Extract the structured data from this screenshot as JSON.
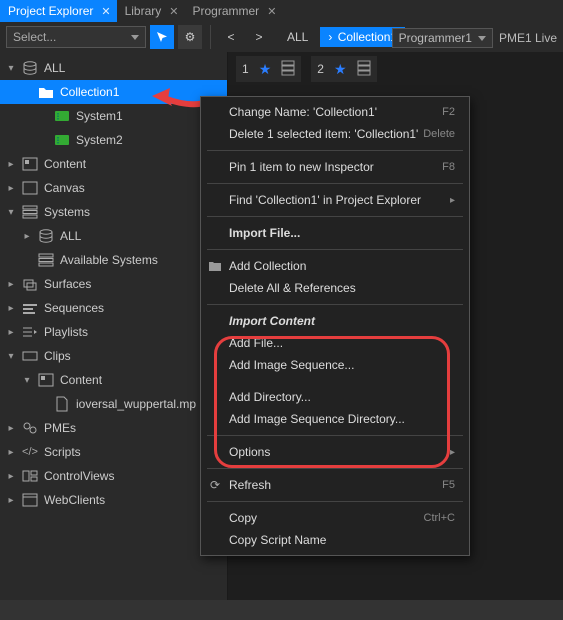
{
  "tabs": [
    {
      "label": "Project Explorer",
      "active": true
    },
    {
      "label": "Library",
      "active": false
    },
    {
      "label": "Programmer",
      "active": false
    }
  ],
  "toolbar": {
    "select_placeholder": "Select...",
    "nav_back": "<",
    "nav_fwd": ">"
  },
  "breadcrumb": [
    {
      "label": "ALL",
      "active": false
    },
    {
      "label": "Collection1",
      "active": true
    }
  ],
  "header_right": {
    "dropdown": "Programmer1",
    "pme": "PME1 Live"
  },
  "thumbs": [
    {
      "num": "1"
    },
    {
      "num": "2"
    }
  ],
  "tree": [
    {
      "indent": 0,
      "exp": "down",
      "icon": "db",
      "label": "ALL"
    },
    {
      "indent": 1,
      "exp": "",
      "icon": "folder",
      "label": "Collection1",
      "selected": true
    },
    {
      "indent": 2,
      "exp": "",
      "icon": "system",
      "label": "System1"
    },
    {
      "indent": 2,
      "exp": "",
      "icon": "system",
      "label": "System2"
    },
    {
      "indent": 0,
      "exp": "right",
      "icon": "content",
      "label": "Content"
    },
    {
      "indent": 0,
      "exp": "right",
      "icon": "canvas",
      "label": "Canvas"
    },
    {
      "indent": 0,
      "exp": "down",
      "icon": "systems",
      "label": "Systems"
    },
    {
      "indent": 1,
      "exp": "right",
      "icon": "db",
      "label": "ALL"
    },
    {
      "indent": 1,
      "exp": "",
      "icon": "systems",
      "label": "Available Systems"
    },
    {
      "indent": 0,
      "exp": "right",
      "icon": "surfaces",
      "label": "Surfaces"
    },
    {
      "indent": 0,
      "exp": "right",
      "icon": "sequences",
      "label": "Sequences"
    },
    {
      "indent": 0,
      "exp": "right",
      "icon": "playlists",
      "label": "Playlists"
    },
    {
      "indent": 0,
      "exp": "down",
      "icon": "clips",
      "label": "Clips"
    },
    {
      "indent": 1,
      "exp": "down",
      "icon": "content",
      "label": "Content"
    },
    {
      "indent": 2,
      "exp": "",
      "icon": "file",
      "label": "ioversal_wuppertal.mp"
    },
    {
      "indent": 0,
      "exp": "right",
      "icon": "pmes",
      "label": "PMEs"
    },
    {
      "indent": 0,
      "exp": "right",
      "icon": "scripts",
      "label": "Scripts"
    },
    {
      "indent": 0,
      "exp": "right",
      "icon": "views",
      "label": "ControlViews"
    },
    {
      "indent": 0,
      "exp": "right",
      "icon": "web",
      "label": "WebClients"
    }
  ],
  "menu": [
    {
      "type": "item",
      "label": "Change Name: 'Collection1'",
      "shortcut": "F2"
    },
    {
      "type": "item",
      "label": "Delete 1 selected item: 'Collection1'",
      "shortcut": "Delete"
    },
    {
      "type": "sep"
    },
    {
      "type": "item",
      "label": "Pin 1 item to new Inspector",
      "shortcut": "F8"
    },
    {
      "type": "sep"
    },
    {
      "type": "item",
      "label": "Find 'Collection1' in Project Explorer",
      "chev": true
    },
    {
      "type": "sep"
    },
    {
      "type": "item",
      "label": "Import File...",
      "bold": true
    },
    {
      "type": "sep"
    },
    {
      "type": "item",
      "label": "Add Collection",
      "icon": "folder+"
    },
    {
      "type": "item",
      "label": "Delete All & References"
    },
    {
      "type": "sep"
    },
    {
      "type": "item",
      "label": "Import Content",
      "bold": true,
      "italic": true
    },
    {
      "type": "item",
      "label": "Add File..."
    },
    {
      "type": "item",
      "label": "Add Image Sequence..."
    },
    {
      "type": "spacer"
    },
    {
      "type": "item",
      "label": "Add Directory..."
    },
    {
      "type": "item",
      "label": "Add Image Sequence Directory..."
    },
    {
      "type": "sep"
    },
    {
      "type": "item",
      "label": "Options",
      "chev": true
    },
    {
      "type": "sep"
    },
    {
      "type": "item",
      "label": "Refresh",
      "shortcut": "F5",
      "icon": "refresh"
    },
    {
      "type": "sep"
    },
    {
      "type": "item",
      "label": "Copy",
      "shortcut": "Ctrl+C"
    },
    {
      "type": "item",
      "label": "Copy Script Name"
    }
  ]
}
